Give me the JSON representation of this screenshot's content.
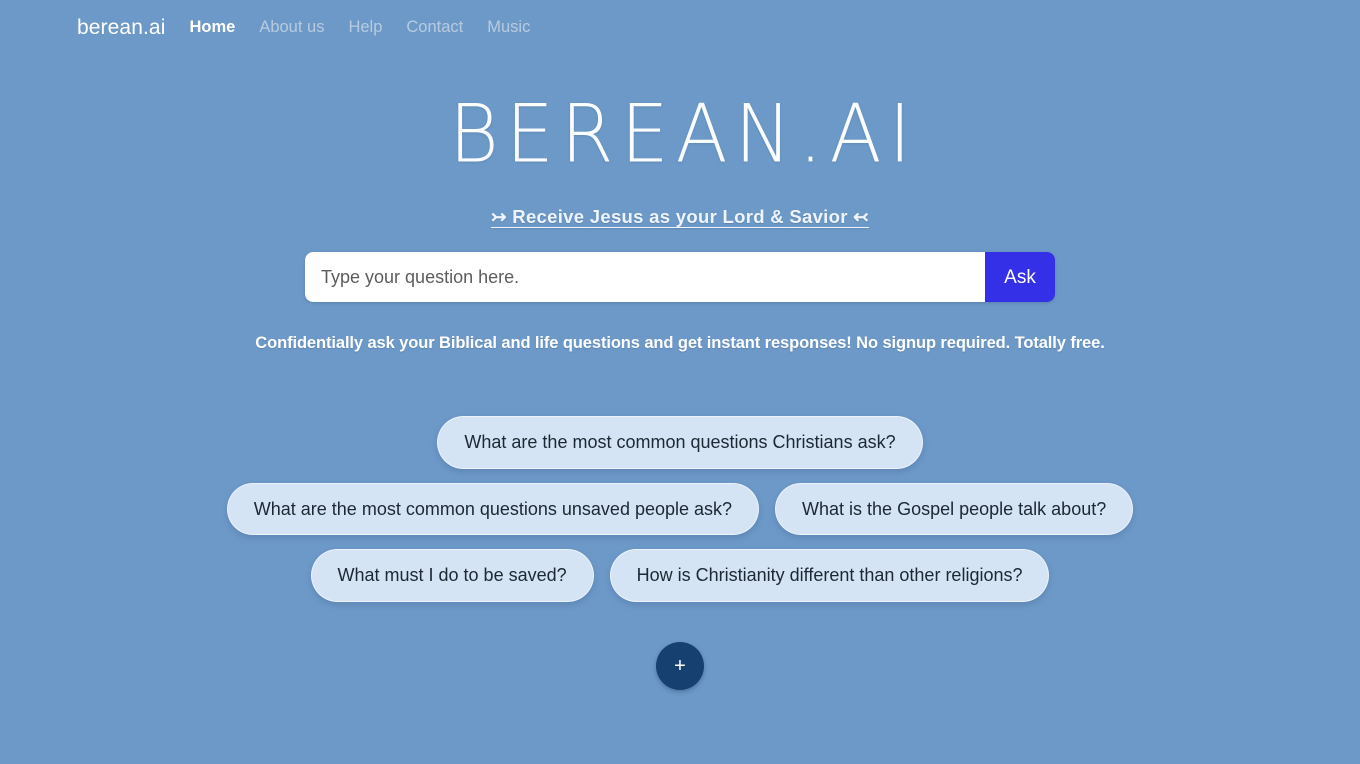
{
  "nav": {
    "brand": "berean.ai",
    "links": [
      {
        "label": "Home",
        "active": true
      },
      {
        "label": "About us",
        "active": false
      },
      {
        "label": "Help",
        "active": false
      },
      {
        "label": "Contact",
        "active": false
      },
      {
        "label": "Music",
        "active": false
      }
    ]
  },
  "hero": {
    "wordmark": "BEREAN.AI",
    "tagline": "↣ Receive Jesus as your Lord & Savior ↢",
    "subtitle": "Confidentially ask your Biblical and life questions and get instant responses! No signup required. Totally free."
  },
  "search": {
    "value": "",
    "placeholder": "Type your question here.",
    "button_label": "Ask"
  },
  "suggestions": {
    "rows": [
      [
        {
          "label": "What are the most common questions Christians ask?"
        }
      ],
      [
        {
          "label": "What are the most common questions unsaved people ask?"
        },
        {
          "label": "What is the Gospel people talk about?"
        }
      ],
      [
        {
          "label": "What must I do to be saved?"
        },
        {
          "label": "How is Christianity different than other religions?"
        }
      ]
    ],
    "add_label": "+"
  },
  "colors": {
    "background": "#6d99c8",
    "accent": "#3430e8",
    "pill_background": "#d4e4f4",
    "add_button": "#164070",
    "nav_inactive": "#b7cbe0"
  }
}
